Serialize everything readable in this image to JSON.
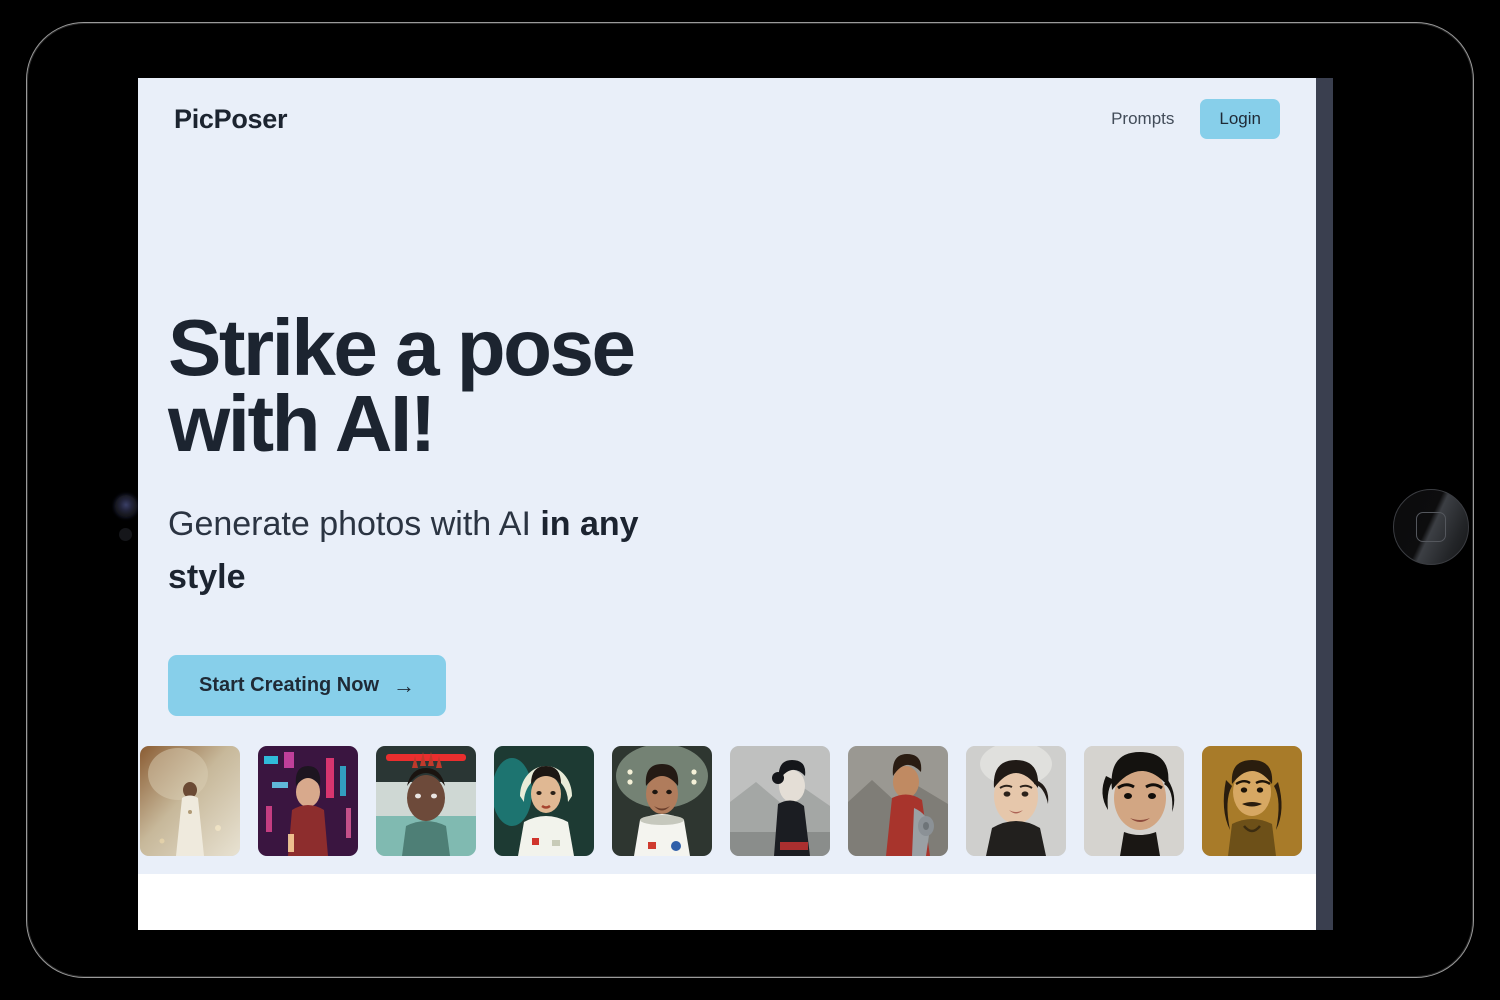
{
  "device": {
    "type": "tablet-frame",
    "camera_icon": "front-camera",
    "home_button_icon": "home-button"
  },
  "nav": {
    "logo": "PicPoser",
    "links": [
      {
        "label": "Prompts"
      }
    ],
    "login_label": "Login"
  },
  "hero": {
    "title": "Strike a pose with AI!",
    "subtitle_normal": "Generate photos with AI ",
    "subtitle_bold": "in any style",
    "cta_label": "Start Creating Now",
    "cta_arrow": "→"
  },
  "gallery": {
    "items": [
      {
        "name": "robed-figure-misty-forest",
        "alt": "Bearded man in light robe standing in misty golden forest"
      },
      {
        "name": "cyberpunk-neon-portrait",
        "alt": "Person in red jacket against vivid neon cyberpunk city lights"
      },
      {
        "name": "red-mohawk-neon-portrait",
        "alt": "Man with red spiked hair under red neon glow"
      },
      {
        "name": "astronaut-woman-green",
        "alt": "Woman in white spacesuit with green helmet visor"
      },
      {
        "name": "astronaut-man-spacesuit",
        "alt": "Man with curly hair in white astronaut suit inside capsule"
      },
      {
        "name": "grayscale-profile-landscape",
        "alt": "Profile of woman in dark clothing against gray mountain landscape"
      },
      {
        "name": "warrior-red-cape",
        "alt": "Armored warrior with red cape in desert landscape"
      },
      {
        "name": "portrait-woman-neutral",
        "alt": "Close portrait of woman with tied-back dark hair on gray background"
      },
      {
        "name": "samurai-man-portrait",
        "alt": "Intense man with long dark hair, dramatic lighting"
      },
      {
        "name": "pirate-golden-portrait",
        "alt": "Man with dreadlocks and mustache in warm golden tones"
      }
    ]
  },
  "colors": {
    "page_background": "#e9eff9",
    "accent": "#87cfea",
    "text_dark": "#1c2430",
    "footer": "#ffffff",
    "scrollbar": "#3a3f4f"
  }
}
